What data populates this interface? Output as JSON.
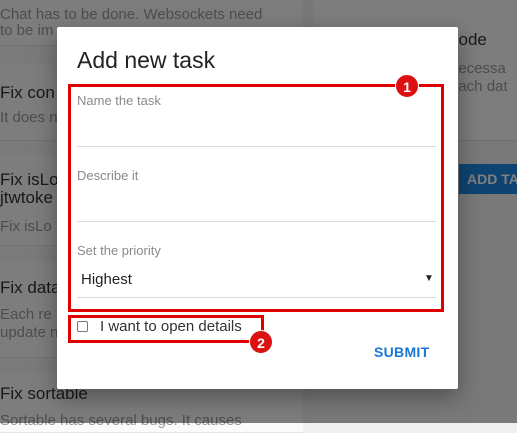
{
  "background": {
    "cards": [
      {
        "title": "",
        "text": [
          "Chat has to be done. Websockets need",
          "to be im"
        ]
      },
      {
        "title": "Fix con",
        "text": [
          "It does n"
        ]
      },
      {
        "title": "Fix isLo",
        "title2": "jtwtoke",
        "text": [
          "Fix isLo"
        ]
      },
      {
        "title": "Fix data",
        "text": [
          "Each re",
          "update n"
        ]
      },
      {
        "title": "Fix sortable",
        "text": [
          "Sortable has several bugs. It causes"
        ]
      }
    ],
    "right_card": {
      "title": "code",
      "text": [
        "necessa",
        "each dat"
      ]
    },
    "right_button": "ADD TA"
  },
  "dialog": {
    "title": "Add new task",
    "fields": {
      "name_label": "Name the task",
      "name_value": "",
      "describe_label": "Describe it",
      "describe_value": "",
      "priority_label": "Set the priority",
      "priority_value": "Highest"
    },
    "checkbox_label": "I want to open details",
    "checkbox_checked": false,
    "submit_label": "SUBMIT"
  },
  "annotations": {
    "marker_1": "1",
    "marker_2": "2",
    "highlight_color": "#e00000"
  },
  "colors": {
    "accent": "#1976d2",
    "button": "#1e88e5",
    "overlay": "rgba(0,0,0,0.5)"
  }
}
